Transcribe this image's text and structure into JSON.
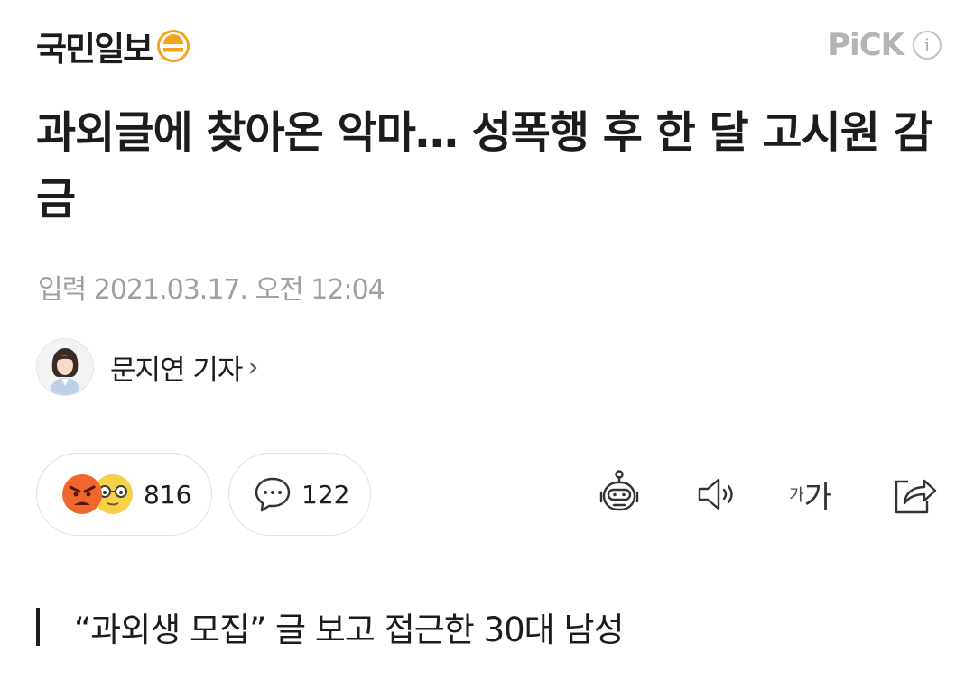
{
  "header": {
    "logo_text": "국민일보",
    "logo_icon": "kukmin-logo-icon",
    "pick_label": "PiCK",
    "info_label": "i",
    "brand_color": "#f2a51a"
  },
  "article": {
    "title": "과외글에 찾아온 악마… 성폭행 후 한 달 고시원 감금",
    "date": "입력 2021.03.17. 오전 12:04",
    "reporter": "문지연 기자",
    "reporter_chevron": "›",
    "subheading": "“과외생 모집” 글 보고 접근한 30대 남성"
  },
  "reactions": {
    "count": "816",
    "icons": [
      "angry-face-icon",
      "glasses-face-icon"
    ],
    "angry_color": "#f0672e",
    "glasses_color": "#f7d04a"
  },
  "comments": {
    "count": "122",
    "icon": "comment-bubble-icon"
  },
  "tools": {
    "font_small": "가",
    "font_large": "가",
    "icons": [
      "robot-icon",
      "speaker-icon",
      "font-size-icon",
      "share-icon"
    ]
  }
}
